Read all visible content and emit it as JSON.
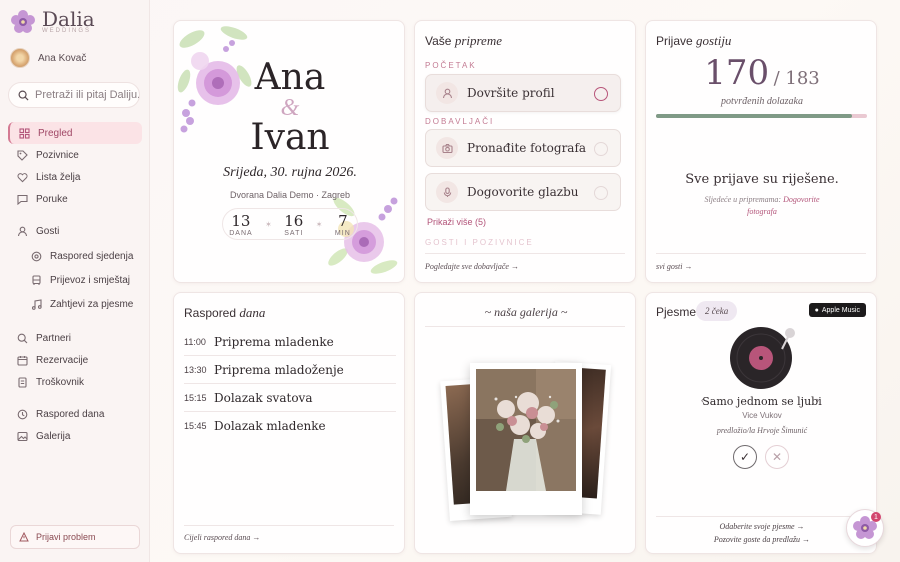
{
  "brand": {
    "name": "Dalia",
    "sub": "WEDDINGS"
  },
  "user": {
    "name": "Ana Kovač"
  },
  "search": {
    "placeholder": "Pretraži ili pitaj Daliju..."
  },
  "nav": {
    "pregled": "Pregled",
    "pozivnice": "Pozivnice",
    "lista_zelja": "Lista želja",
    "poruke": "Poruke",
    "gosti": "Gosti",
    "raspored_sjedenja": "Raspored sjedenja",
    "prijevoz": "Prijevoz i smještaj",
    "zahtjevi": "Zahtjevi za pjesme",
    "partneri": "Partneri",
    "rezervacije": "Rezervacije",
    "troskovnik": "Troškovnik",
    "raspored_dana": "Raspored dana",
    "galerija": "Galerija"
  },
  "report": "Prijavi problem",
  "couple": {
    "name1": "Ana",
    "amp": "&",
    "name2": "Ivan",
    "date": "Srijeda, 30. rujna 2026.",
    "venue": "Dvorana Dalia Demo · Zagreb",
    "countdown": [
      {
        "n": "13",
        "u": "DANA"
      },
      {
        "n": "16",
        "u": "SATI"
      },
      {
        "n": "7",
        "u": "MIN"
      }
    ]
  },
  "prep": {
    "title_a": "Vaše",
    "title_b": "pripreme",
    "sec1": "POČETAK",
    "sec2": "DOBAVLJAČI",
    "sec3": "GOSTI I POZIVNICE",
    "task1": "Dovršite profil",
    "task2": "Pronađite fotografa",
    "task3": "Dogovorite glazbu",
    "more": "Prikaži više (5)",
    "footer": "Pogledajte sve dobavljače →"
  },
  "rsvp": {
    "title_a": "Prijave",
    "title_b": "gostiju",
    "confirmed": "170",
    "total": "/ 183",
    "caption": "potvrđenih dolazaka",
    "progress": 0.929,
    "done": "Sve prijave su riješene.",
    "next_a": "Sljedeće u pripremama:",
    "next_b": "Dogovorite",
    "next_c": "fotografa",
    "footer": "svi gosti →"
  },
  "schedule": {
    "title_a": "Raspored",
    "title_b": "dana",
    "items": [
      {
        "time": "11:00",
        "label": "Priprema mladenke"
      },
      {
        "time": "13:30",
        "label": "Priprema mladoženje"
      },
      {
        "time": "15:15",
        "label": "Dolazak svatova"
      },
      {
        "time": "15:45",
        "label": "Dolazak mladenke"
      }
    ],
    "footer": "Cijeli raspored dana →"
  },
  "gallery": {
    "title": "~ naša galerija ~"
  },
  "songs": {
    "title": "Pjesme",
    "badge": "2 čeka",
    "provider": "Apple Music",
    "song": "Samo jednom se ljubi",
    "artist": "Vice Vukov",
    "suggested": "predložio/la Hrvoje Šimunić",
    "link1": "Odaberite svoje pjesme →",
    "link2": "Pozovite goste da predlažu →"
  },
  "chat_badge": "1",
  "colors": {
    "accent": "#b3557a",
    "progress": "#7f9a86",
    "active_nav": "#fbe3e6"
  }
}
